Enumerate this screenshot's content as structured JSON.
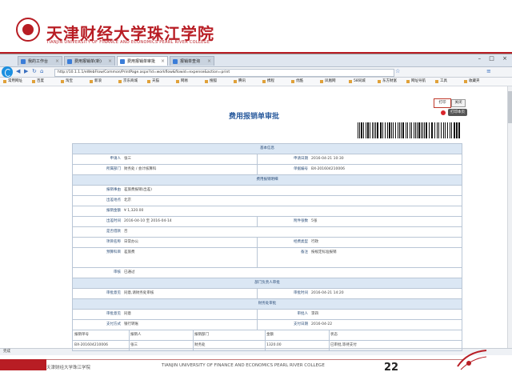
{
  "banner": {
    "school_cn": "天津财经大学珠江学院",
    "school_en": "TIANJIN UNIVERSITY OF FINANCE AND ECONOMICS PEARL RIVER COLLEGE"
  },
  "browser": {
    "tabs": [
      {
        "label": "我的工作台"
      },
      {
        "label": "费用报销单(新)"
      },
      {
        "label": "费用报销单审批"
      },
      {
        "label": "报销单查询"
      }
    ],
    "address": "http://10.1.1.1/eWebFlow/Common/PrintPage.aspx?id=workflow&flowid=expense&action=print",
    "bookmarks": [
      "常用网址",
      "百度",
      "淘宝",
      "新浪",
      "京东商城",
      "天猫",
      "网易",
      "搜狐",
      "腾讯",
      "携程",
      "优酷",
      "凤凰网",
      "58同城",
      "东方财富",
      "网址导航",
      "工具",
      "收藏夹"
    ],
    "status": "完成"
  },
  "page": {
    "title": "费用报销单审批",
    "print_label": "打印",
    "close_label": "关闭",
    "tooltip": "打印本页"
  },
  "form": {
    "rows": [
      {
        "type": "head",
        "text": "基本信息"
      },
      {
        "type": "pair",
        "l1": "申请人",
        "v1": "张三",
        "l2": "申请日期",
        "v2": "2016-04-21 10:30"
      },
      {
        "type": "pair",
        "l1": "所属部门",
        "v1": "财务处 / 会计核算科",
        "l2": "单据编号",
        "v2": "BX-201604210006"
      },
      {
        "type": "head",
        "text": "费用报销明细"
      },
      {
        "type": "single",
        "l1": "报销事由",
        "v1": "差旅费报销(出差)"
      },
      {
        "type": "single",
        "l1": "出差地点",
        "v1": "北京"
      },
      {
        "type": "single",
        "l1": "报销金额",
        "v1": "¥ 1,320.00"
      },
      {
        "type": "pair",
        "l1": "出差时间",
        "v1": "2016-04-10 至 2016-04-14",
        "l2": "附件张数",
        "v2": "5张"
      },
      {
        "type": "single",
        "l1": "是否借款",
        "v1": "否"
      },
      {
        "type": "pair",
        "l1": "项目名称",
        "v1": "日常办公",
        "l2": "经费类型",
        "v2": "行政"
      },
      {
        "type": "tallpair",
        "l1": "预算科目",
        "v1": "差旅费",
        "l2": "备注",
        "v2": "按规定标准报销"
      },
      {
        "type": "single",
        "l1": "审核",
        "v1": "已通过"
      },
      {
        "type": "head",
        "text": "部门负责人审批"
      },
      {
        "type": "pair",
        "l1": "审批意见",
        "v1": "同意,请财务处审核",
        "l2": "审批时间",
        "v2": "2016-04-21 14:20"
      },
      {
        "type": "head",
        "text": "财务处审批"
      },
      {
        "type": "pair",
        "l1": "审批意见",
        "v1": "同意",
        "l2": "审批人",
        "v2": "李四"
      },
      {
        "type": "pair",
        "l1": "支付方式",
        "v1": "银行转账",
        "l2": "支付日期",
        "v2": "2016-04-22"
      },
      {
        "type": "five",
        "cols": [
          "报销单号",
          "报销人",
          "报销部门",
          "金额",
          "状态"
        ]
      },
      {
        "type": "five",
        "cols": [
          "BX-201604210006",
          "张三",
          "财务处",
          "1320.00",
          "已审批,等待支付"
        ]
      }
    ]
  },
  "footer": {
    "left": "天津财经大学珠江学院",
    "mid": "TIANJIN UNIVERSITY OF FINANCE AND ECONOMICS PEARL RIVER COLLEGE",
    "page_num": "22"
  },
  "colors": {
    "brand": "#b81d24",
    "accent": "#2b5c9e"
  }
}
